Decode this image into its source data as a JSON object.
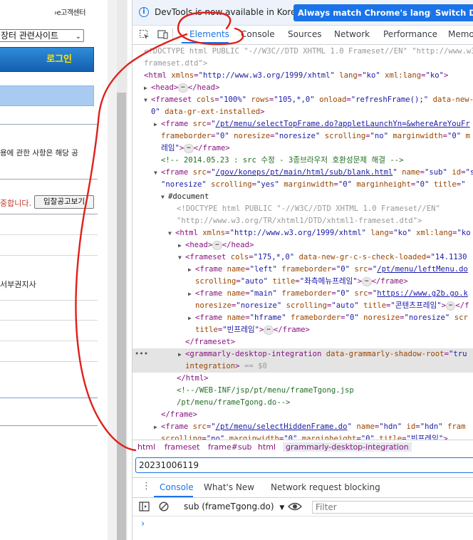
{
  "left_page": {
    "customer_center": "›e고객센터",
    "select_value": "장터 관련사이트",
    "login_label": "로그인",
    "notice_text": "용에 관한 사항은 해당 공",
    "red_text": "중합니다.",
    "bid_button": "입찰공고보기",
    "branch_text": "서부권지사"
  },
  "devtools": {
    "info_bar": {
      "message": "DevTools is now available in Korean!",
      "match_button": "Always match Chrome's language",
      "switch_button": "Switch De"
    },
    "tabs": [
      "Elements",
      "Console",
      "Sources",
      "Network",
      "Performance",
      "Memo"
    ],
    "active_tab": "Elements",
    "breadcrumb": [
      "html",
      "frameset",
      "frame#sub",
      "html",
      "grammarly-desktop-integration"
    ],
    "search_value": "20231006119",
    "drawer": {
      "tabs": [
        "Console",
        "What's New",
        "Network request blocking"
      ],
      "context": "sub (frameTgong.do)",
      "filter_placeholder": "Filter",
      "prompt": "›"
    }
  },
  "colors": {
    "accent": "#1a73e8",
    "login_text": "#ffe600",
    "annotation": "#e0201b"
  }
}
